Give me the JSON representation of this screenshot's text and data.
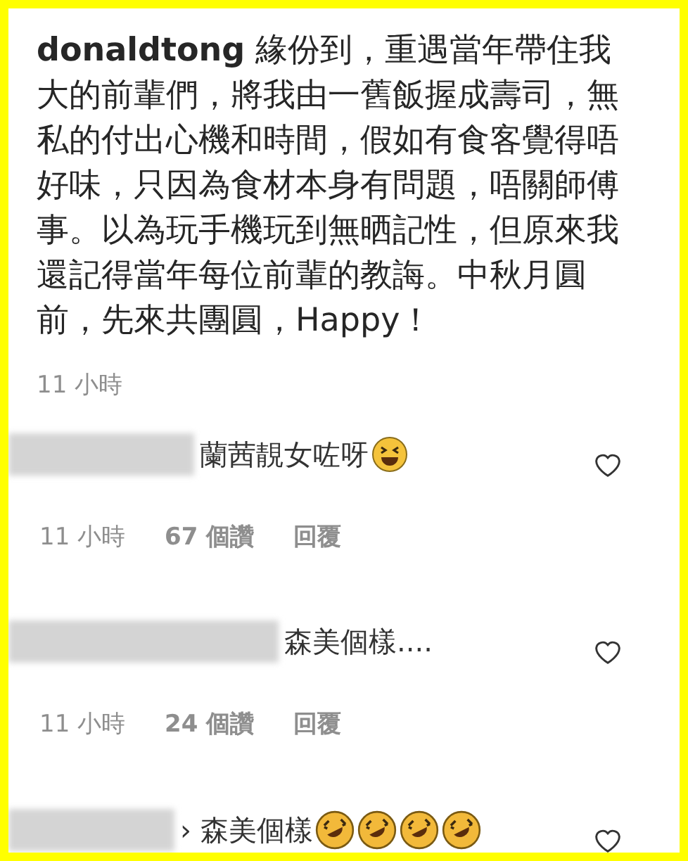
{
  "caption": {
    "username": "donaldtong",
    "text": "緣份到，重遇當年帶住我大的前輩們，將我由一舊飯握成壽司，無私的付出心機和時間，假如有食客覺得唔好味，只因為食材本身有問題，唔關師傅事。以為玩手機玩到無晒記性，但原來我還記得當年每位前輩的教誨。中秋月圓前，先來共團圓，Happy！",
    "time": "11 小時"
  },
  "comments": [
    {
      "text": "蘭茜靚女咗呀",
      "emojis": [
        {
          "kind": "grin"
        }
      ],
      "time": "11 小時",
      "likes": "67 個讚",
      "reply": "回覆"
    },
    {
      "text": "森美個樣....",
      "time": "11 小時",
      "likes": "24 個讚",
      "reply": "回覆"
    },
    {
      "text": "› 森美個樣",
      "emojis": [
        {
          "kind": "rofl"
        },
        {
          "kind": "rofl"
        },
        {
          "kind": "rofl"
        },
        {
          "kind": "rofl"
        }
      ]
    }
  ]
}
